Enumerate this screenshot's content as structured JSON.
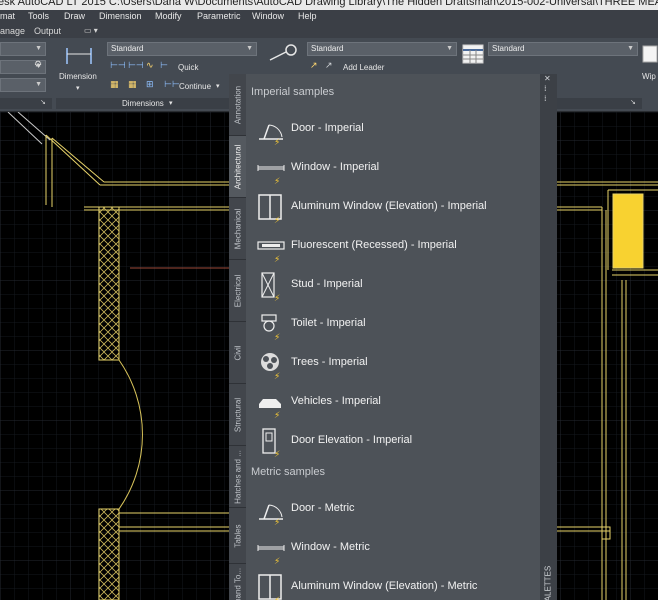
{
  "title_bar": {
    "text": "esk AutoCAD LT 2015    C:\\Users\\Dana W\\Documents\\AutoCAD Drawing Library\\The Hidden Draftsman\\2015-002-Universal\\THREE MEAL"
  },
  "menu_bar": {
    "items": [
      "mat",
      "Tools",
      "Draw",
      "Dimension",
      "Modify",
      "Parametric",
      "Window",
      "Help"
    ]
  },
  "ribbon_tabs": {
    "items": [
      "anage",
      "Output"
    ]
  },
  "ribbon": {
    "dim_style": "Standard",
    "dimension_label": "Dimension",
    "quick_label": "Quick",
    "continue_label": "Continue",
    "dimensions_panel": "Dimensions",
    "mleader_style": "Standard",
    "add_leader": "Add Leader",
    "table_style": "Standard",
    "wipeout_label": "Wip"
  },
  "palette": {
    "tabs": [
      "Annotation",
      "Architectural",
      "Mechanical",
      "Electrical",
      "Civil",
      "Structural",
      "Hatches and ...",
      "Tables",
      "Command To..."
    ],
    "active_tab": "Architectural",
    "all_palettes": "ALL PALETTES",
    "imperial_header": "Imperial samples",
    "imperial_items": [
      {
        "label": "Door - Imperial",
        "icon": "door-icon"
      },
      {
        "label": "Window - Imperial",
        "icon": "window-icon"
      },
      {
        "label": "Aluminum Window (Elevation) - Imperial",
        "icon": "aluminum-window-icon"
      },
      {
        "label": "Fluorescent (Recessed) - Imperial",
        "icon": "fluorescent-icon"
      },
      {
        "label": "Stud - Imperial",
        "icon": "stud-icon"
      },
      {
        "label": "Toilet - Imperial",
        "icon": "toilet-icon"
      },
      {
        "label": "Trees - Imperial",
        "icon": "tree-icon"
      },
      {
        "label": "Vehicles - Imperial",
        "icon": "vehicle-icon"
      },
      {
        "label": "Door Elevation - Imperial",
        "icon": "door-elevation-icon"
      }
    ],
    "metric_header": "Metric samples",
    "metric_items": [
      {
        "label": "Door - Metric",
        "icon": "door-icon"
      },
      {
        "label": "Window - Metric",
        "icon": "window-icon"
      },
      {
        "label": "Aluminum Window (Elevation) - Metric",
        "icon": "aluminum-window-icon"
      }
    ]
  },
  "colors": {
    "drawing_bg": "#000000",
    "grid": "#1d2127",
    "wall": "#e8d36a",
    "fixture": "#f8d230",
    "palette_bg": "#4d5258",
    "ribbon_bg": "#444a52"
  }
}
